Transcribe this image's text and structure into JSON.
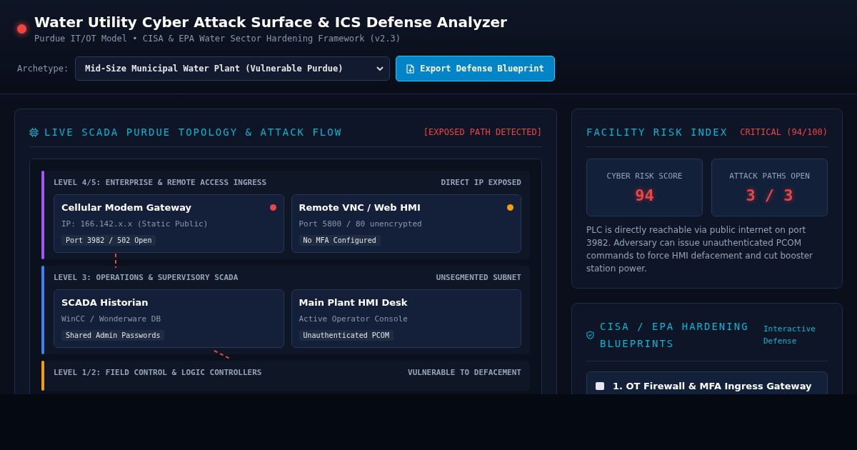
{
  "header": {
    "title": "Water Utility Cyber Attack Surface & ICS Defense Analyzer",
    "subtitle": "Purdue IT/OT Model • CISA & EPA Water Sector Hardening Framework (v2.3)",
    "archetype_label": "Archetype:",
    "archetype_value": "Mid-Size Municipal Water Plant (Vulnerable Purdue)",
    "export_button": "Export Defense Blueprint"
  },
  "topology": {
    "title": "LIVE SCADA PURDUE TOPOLOGY & ATTACK FLOW",
    "alert": "[EXPOSED PATH DETECTED]",
    "levels": [
      {
        "title": "LEVEL 4/5: ENTERPRISE & REMOTE ACCESS INGRESS",
        "tag": "DIRECT IP EXPOSED",
        "color": "#a855f7",
        "nodes": [
          {
            "name": "Cellular Modem Gateway",
            "detail": "IP: 166.142.x.x (Static Public)",
            "badge": "Port 3982 / 502 Open",
            "color": "#ef4444"
          },
          {
            "name": "Remote VNC / Web HMI",
            "detail": "Port 5800 / 80 unencrypted",
            "badge": "No MFA Configured",
            "color": "#f59e0b"
          }
        ]
      },
      {
        "title": "LEVEL 3: OPERATIONS & SUPERVISORY SCADA",
        "tag": "UNSEGMENTED SUBNET",
        "color": "#3b82f6",
        "nodes": [
          {
            "name": "SCADA Historian",
            "detail": "WinCC / Wonderware DB",
            "badge": "Shared Admin Passwords"
          },
          {
            "name": "Main Plant HMI Desk",
            "detail": "Active Operator Console",
            "badge": "Unauthenticated PCOM"
          }
        ]
      },
      {
        "title": "LEVEL 1/2: FIELD CONTROL & LOGIC CONTROLLERS",
        "tag": "VULNERABLE TO DEFACEMENT",
        "color": "#f59e0b"
      }
    ]
  },
  "risk": {
    "title": "FACILITY RISK INDEX",
    "status": "CRITICAL (94/100)",
    "metrics": [
      {
        "label": "CYBER RISK SCORE",
        "value": "94"
      },
      {
        "label": "ATTACK PATHS OPEN",
        "value": "3 / 3"
      }
    ],
    "description": "PLC is directly reachable via public internet on port 3982. Adversary can issue unauthenticated PCOM commands to force HMI defacement and cut booster station power."
  },
  "blueprints": {
    "title": "CISA / EPA HARDENING BLUEPRINTS",
    "tag": "Interactive Defense",
    "items": [
      {
        "label": "1. OT Firewall & MFA Ingress Gateway",
        "checked": false
      }
    ]
  }
}
